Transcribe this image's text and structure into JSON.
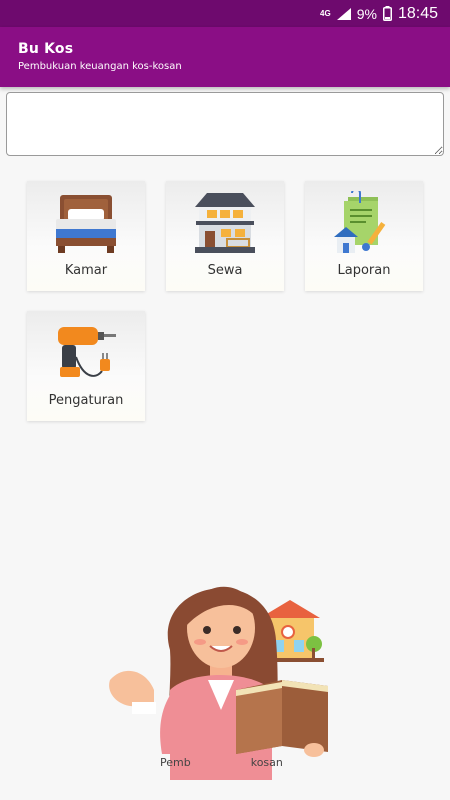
{
  "status_bar": {
    "network": "4G",
    "battery_percent": "9%",
    "time": "18:45"
  },
  "app_bar": {
    "title": "Bu Kos",
    "subtitle": "Pembukuan keuangan kos-kosan"
  },
  "search": {
    "value": "",
    "placeholder": ""
  },
  "menu": {
    "items": [
      {
        "label": "Kamar",
        "icon": "bed-icon"
      },
      {
        "label": "Sewa",
        "icon": "house-icon"
      },
      {
        "label": "Laporan",
        "icon": "report-icon"
      },
      {
        "label": "Pengaturan",
        "icon": "drill-icon"
      }
    ]
  },
  "hero": {
    "caption_left": "Pemb",
    "caption_right": "kosan"
  },
  "colors": {
    "app_bar": "#8a0e85",
    "status_bar": "#6e0a6e"
  }
}
